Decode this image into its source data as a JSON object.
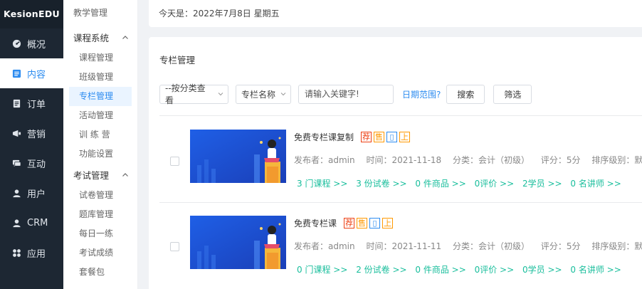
{
  "app": {
    "logo": "KesionEDU"
  },
  "nav": [
    {
      "label": "概况",
      "icon": "dashboard-icon"
    },
    {
      "label": "内容",
      "icon": "content-icon",
      "active": true
    },
    {
      "label": "订单",
      "icon": "order-icon"
    },
    {
      "label": "营销",
      "icon": "marketing-icon"
    },
    {
      "label": "互动",
      "icon": "chat-icon"
    },
    {
      "label": "用户",
      "icon": "user-icon"
    },
    {
      "label": "CRM",
      "icon": "crm-icon"
    },
    {
      "label": "应用",
      "icon": "apps-icon"
    }
  ],
  "subnav": {
    "title": "教学管理",
    "group1": "课程系统",
    "group1_items": [
      "课程管理",
      "班级管理",
      "专栏管理",
      "活动管理",
      "训 练 营",
      "功能设置"
    ],
    "group2": "考试管理",
    "group2_items": [
      "试卷管理",
      "题库管理",
      "每日一练",
      "考试成绩",
      "套餐包"
    ]
  },
  "datebar": {
    "text": "今天是：2022年7月8日 星期五"
  },
  "panel": {
    "title": "专栏管理"
  },
  "filters": {
    "category": "--按分类查看",
    "field": "专栏名称",
    "keyword_placeholder": "请输入关键字!",
    "date_range": "日期范围?",
    "search": "搜索",
    "filter": "筛选"
  },
  "items": [
    {
      "title": "免费专栏课复制",
      "tags": [
        "荐",
        "售",
        "▯",
        "上"
      ],
      "author_label": "发布者：admin",
      "time_label": "时间：2021-11-18",
      "category_label": "分类：会计（初级）",
      "score_label": "评分：5分",
      "rank_label": "排序级别：默认",
      "links": [
        "3 门课程 >>",
        "3 份试卷 >>",
        "0 件商品 >>",
        "0评价 >>",
        "2学员 >>",
        "0 名讲师 >>"
      ]
    },
    {
      "title": "免费专栏课",
      "tags": [
        "荐",
        "售",
        "▯",
        "上"
      ],
      "author_label": "发布者：admin",
      "time_label": "时间：2021-11-11",
      "category_label": "分类：会计（初级）",
      "score_label": "评分：5分",
      "rank_label": "排序级别：默认",
      "links": [
        "0 门课程 >>",
        "2 份试卷 >>",
        "0 件商品 >>",
        "0评价 >>",
        "0学员 >>",
        "0 名讲师 >>"
      ]
    }
  ]
}
